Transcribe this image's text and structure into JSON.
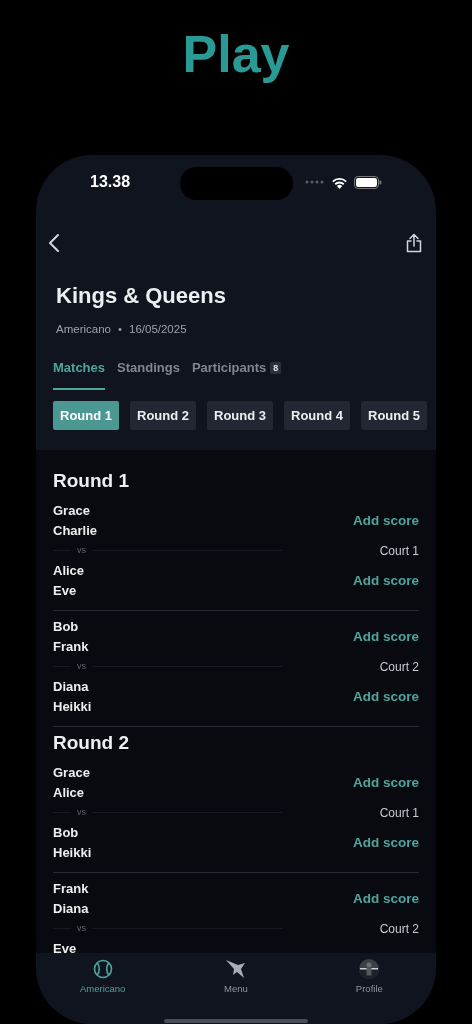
{
  "page_title": "Play",
  "status_bar": {
    "time": "13.38"
  },
  "event": {
    "title": "Kings & Queens",
    "format": "Americano",
    "separator": "•",
    "date": "16/05/2025"
  },
  "tabs": [
    {
      "label": "Matches",
      "selected": true
    },
    {
      "label": "Standings",
      "selected": false
    },
    {
      "label": "Participants",
      "badge": "8",
      "selected": false
    }
  ],
  "round_chips": [
    {
      "label": "Round 1",
      "selected": true
    },
    {
      "label": "Round 2",
      "selected": false
    },
    {
      "label": "Round 3",
      "selected": false
    },
    {
      "label": "Round 4",
      "selected": false
    },
    {
      "label": "Round 5",
      "selected": false
    }
  ],
  "rounds": [
    {
      "title": "Round 1",
      "matches": [
        {
          "teams": [
            {
              "players": [
                "Grace",
                "Charlie"
              ],
              "action": "Add score"
            },
            {
              "players": [
                "Alice",
                "Eve"
              ],
              "action": "Add score"
            }
          ],
          "vs": "vs",
          "court": "Court 1"
        },
        {
          "teams": [
            {
              "players": [
                "Bob",
                "Frank"
              ],
              "action": "Add score"
            },
            {
              "players": [
                "Diana",
                "Heikki"
              ],
              "action": "Add score"
            }
          ],
          "vs": "vs",
          "court": "Court 2"
        }
      ]
    },
    {
      "title": "Round 2",
      "matches": [
        {
          "teams": [
            {
              "players": [
                "Grace",
                "Alice"
              ],
              "action": "Add score"
            },
            {
              "players": [
                "Bob",
                "Heikki"
              ],
              "action": "Add score"
            }
          ],
          "vs": "vs",
          "court": "Court 1"
        },
        {
          "teams": [
            {
              "players": [
                "Frank",
                "Diana"
              ],
              "action": "Add score"
            },
            {
              "players": [
                "Eve"
              ]
            }
          ],
          "vs": "vs",
          "court": "Court 2"
        }
      ]
    }
  ],
  "bottom_nav": [
    {
      "label": "Americano",
      "kind": "ball",
      "selected": true
    },
    {
      "label": "Menu",
      "kind": "star",
      "selected": false
    },
    {
      "label": "Profile",
      "kind": "avatar",
      "selected": false
    }
  ]
}
